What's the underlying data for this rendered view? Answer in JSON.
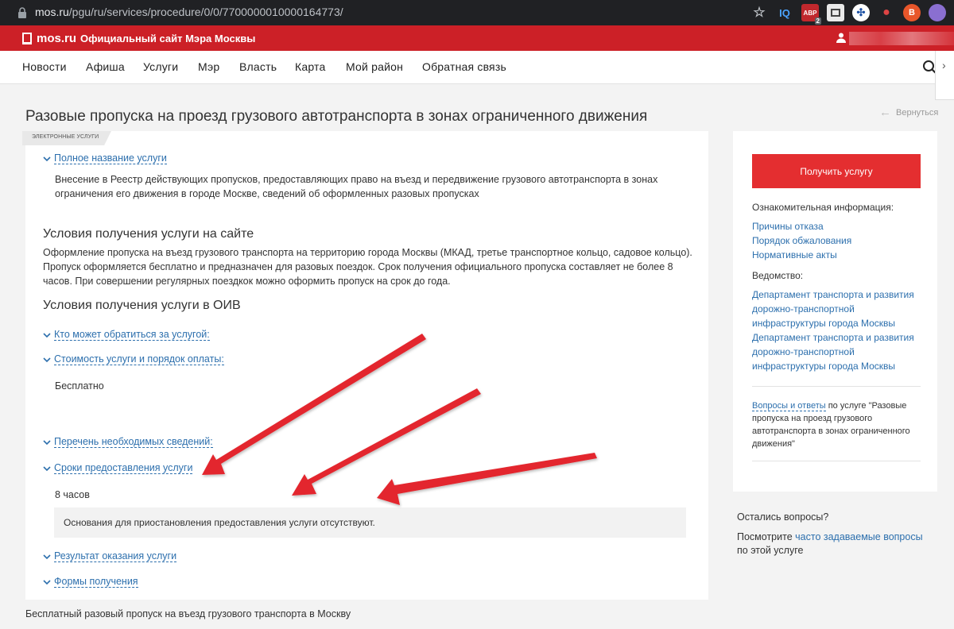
{
  "browser": {
    "url_host": "mos.ru",
    "url_path": "/pgu/ru/services/procedure/0/0/7700000010000164773/",
    "extensions": [
      "IQ",
      "ABP",
      "",
      "",
      "",
      "B",
      ""
    ],
    "extension_badge": "2"
  },
  "header": {
    "logo": "mos.ru",
    "tagline": "Официальный сайт Мэра Москвы"
  },
  "nav": {
    "items": [
      "Новости",
      "Афиша",
      "Услуги",
      "Мэр",
      "Власть",
      "Карта",
      "Мой район",
      "Обратная связь"
    ]
  },
  "page": {
    "title": "Разовые пропуска на проезд грузового автотранспорта в зонах ограниченного движения",
    "back_label": "Вернуться",
    "badge": "Электронные услуги"
  },
  "content": {
    "full_name_link": "Полное название услуги",
    "full_name_text": "Внесение в Реестр действующих пропусков, предоставляющих право на въезд и передвижение грузового автотранспорта в зонах ограничения его движения в городе Москве, сведений об оформленных разовых пропусках",
    "site_heading": "Условия получения услуги на сайте",
    "site_text": "Оформление пропуска на въезд грузового транспорта на территорию города Москвы (МКАД, третье транспортное кольцо, садовое кольцо). Пропуск оформляется бесплатно и предназначен для разовых поездок. Срок получения официального пропуска составляет не более 8 часов. При совершении регулярных поездкок можно оформить пропуск на срок до года.",
    "oiv_heading": "Условия получения услуги в ОИВ",
    "who_link": "Кто может обратиться за услугой:",
    "cost_link": "Стоимость услуги и порядок оплаты:",
    "cost_value": "Бесплатно",
    "docs_link": "Перечень необходимых сведений:",
    "terms_link": "Сроки предоставления услуги",
    "terms_value": "8 часов",
    "suspension_note": "Основания для приостановления предоставления услуги отсутствуют.",
    "result_link": "Результат оказания услуги",
    "forms_link": "Формы получения"
  },
  "sidebar": {
    "get_button": "Получить услугу",
    "info_label": "Ознакомительная информация:",
    "info_links": [
      "Причины отказа",
      "Порядок обжалования",
      "Нормативные акты"
    ],
    "agency_label": "Ведомство:",
    "agency_links": [
      "Департамент транспорта и развития",
      "дорожно-транспортной",
      "инфраструктуры города Москвы",
      "Департамент транспорта и развития",
      "дорожно-транспортной",
      "инфраструктуры города Москвы"
    ],
    "faq_link": "Вопросы и ответы",
    "faq_text": " по услуге \"Разовые пропуска на проезд грузового автотранспорта в зонах ограниченного движения\""
  },
  "questions": {
    "title": "Остались вопросы?",
    "text_before": "Посмотрите ",
    "link": "часто задаваемые вопросы",
    "text_after": " по этой услуге"
  },
  "caption": "Бесплатный разовый пропуск на въезд грузового транспорта в Москву",
  "colors": {
    "brand_red": "#cc2027",
    "button_red": "#e42e30",
    "link_blue": "#2c6fad",
    "arrow_red": "#e3272d"
  }
}
